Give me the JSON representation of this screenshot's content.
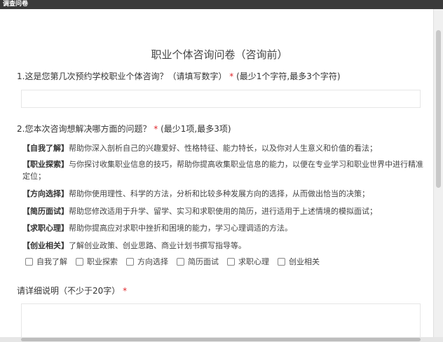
{
  "window": {
    "title": "调查问卷"
  },
  "survey": {
    "title": "职业个体咨询问卷（咨询前）",
    "q1": {
      "text": "1.这是您第几次预约学校职业个体咨询？（请填写数字）",
      "required": "*",
      "hint": "(最少1个字符,最多3个字符)",
      "value": ""
    },
    "q2": {
      "text": "2.您本次咨询想解决哪方面的问题？",
      "required": "*",
      "hint": "(最少1项,最多3项)",
      "options": [
        {
          "tag": "【自我了解】",
          "desc": "帮助你深入剖析自己的兴趣爱好、性格特征、能力特长，以及你对人生意义和价值的看法；"
        },
        {
          "tag": "【职业探索】",
          "desc": "与你探讨收集职业信息的技巧，帮助你提高收集职业信息的能力，以便在专业学习和职业世界中进行精准定位；"
        },
        {
          "tag": "【方向选择】",
          "desc": "帮助你使用理性、科学的方法，分析和比较多种发展方向的选择，从而做出恰当的决策；"
        },
        {
          "tag": "【简历面试】",
          "desc": "帮助您修改适用于升学、留学、实习和求职使用的简历，进行适用于上述情境的模拟面试；"
        },
        {
          "tag": "【求职心理】",
          "desc": "帮助你提高应对求职中挫折和困境的能力，学习心理调适的方法。"
        },
        {
          "tag": "【创业相关】",
          "desc": "了解创业政策、创业思路、商业计划书撰写指导等。"
        }
      ],
      "checkboxes": [
        "自我了解",
        "职业探索",
        "方向选择",
        "简历面试",
        "求职心理",
        "创业相关"
      ]
    },
    "q3": {
      "text": "请详细说明（不少于20字）",
      "required": "*",
      "value": ""
    }
  }
}
